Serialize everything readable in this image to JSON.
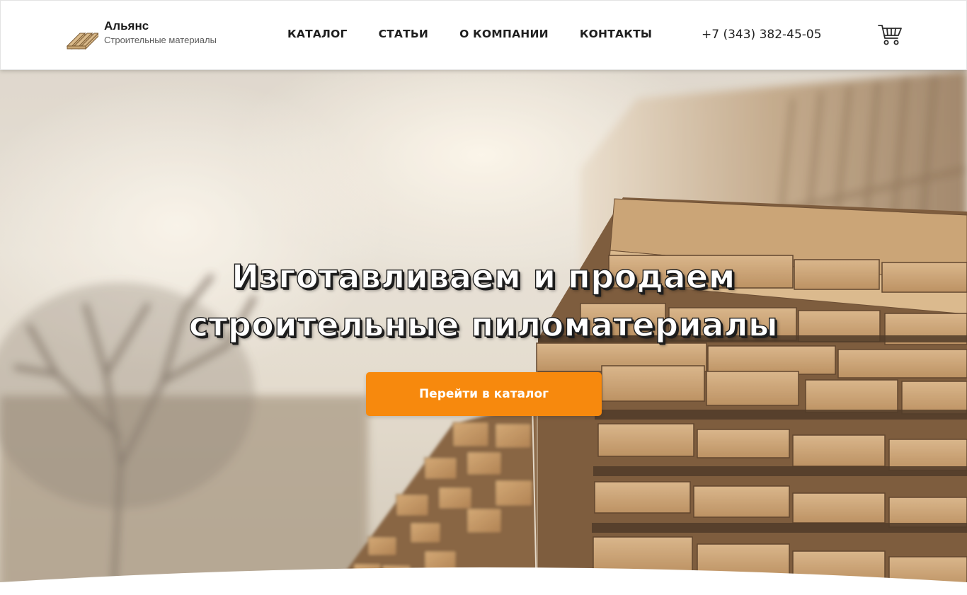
{
  "header": {
    "brand_name": "Альянс",
    "brand_tagline": "Строительные материалы",
    "nav": [
      {
        "label": "КАТАЛОГ"
      },
      {
        "label": "СТАТЬИ"
      },
      {
        "label": "О КОМПАНИИ"
      },
      {
        "label": "КОНТАКТЫ"
      }
    ],
    "phone": "+7 (343) 382-45-05",
    "cart_icon": "shopping-cart-icon"
  },
  "hero": {
    "title_line1": "Изготавливаем и продаем",
    "title_line2": "строительные пиломатериалы",
    "cta_label": "Перейти в каталог",
    "background": "stacked lumber boards photo"
  },
  "colors": {
    "accent": "#f7890d",
    "text_dark": "#1f1f1f",
    "header_bg": "#ffffff"
  }
}
